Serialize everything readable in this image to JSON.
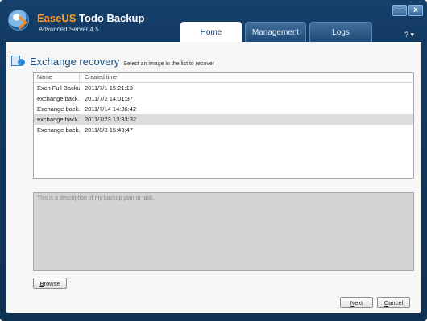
{
  "app": {
    "brand_part1": "EaseUS",
    "brand_part2": "Todo Backup",
    "edition": "Advanced Server 4.5",
    "accent_color": "#ff9b2e"
  },
  "window_controls": {
    "minimize_label": "–",
    "close_label": "x",
    "help_label": "? ▾"
  },
  "tabs": [
    {
      "label": "Home",
      "active": true
    },
    {
      "label": "Management",
      "active": false
    },
    {
      "label": "Logs",
      "active": false
    }
  ],
  "page": {
    "title": "Exchange recovery",
    "subtitle": "Select an image in the list to recover",
    "icon": "exchange-recovery-icon"
  },
  "image_list": {
    "columns": {
      "name": "Name",
      "created": "Created time"
    },
    "rows": [
      {
        "name": "Exch Full Backu...",
        "created": "2011/7/1 15:21:13",
        "selected": false
      },
      {
        "name": "exchange back...",
        "created": "2011/7/2 14:01:37",
        "selected": false
      },
      {
        "name": "Exchange back...",
        "created": "2011/7/14 14:36:42",
        "selected": false
      },
      {
        "name": "exchange back...",
        "created": "2011/7/23 13:33:32",
        "selected": true
      },
      {
        "name": "Exchange back...",
        "created": "2011/8/3 15:43:47",
        "selected": false
      }
    ]
  },
  "description": {
    "text": "This is a description of my backup plan or task."
  },
  "buttons": {
    "browse": {
      "first": "B",
      "rest": "rowse"
    },
    "next": {
      "first": "N",
      "rest": "ext"
    },
    "cancel": {
      "first": "C",
      "rest": "ancel"
    }
  }
}
